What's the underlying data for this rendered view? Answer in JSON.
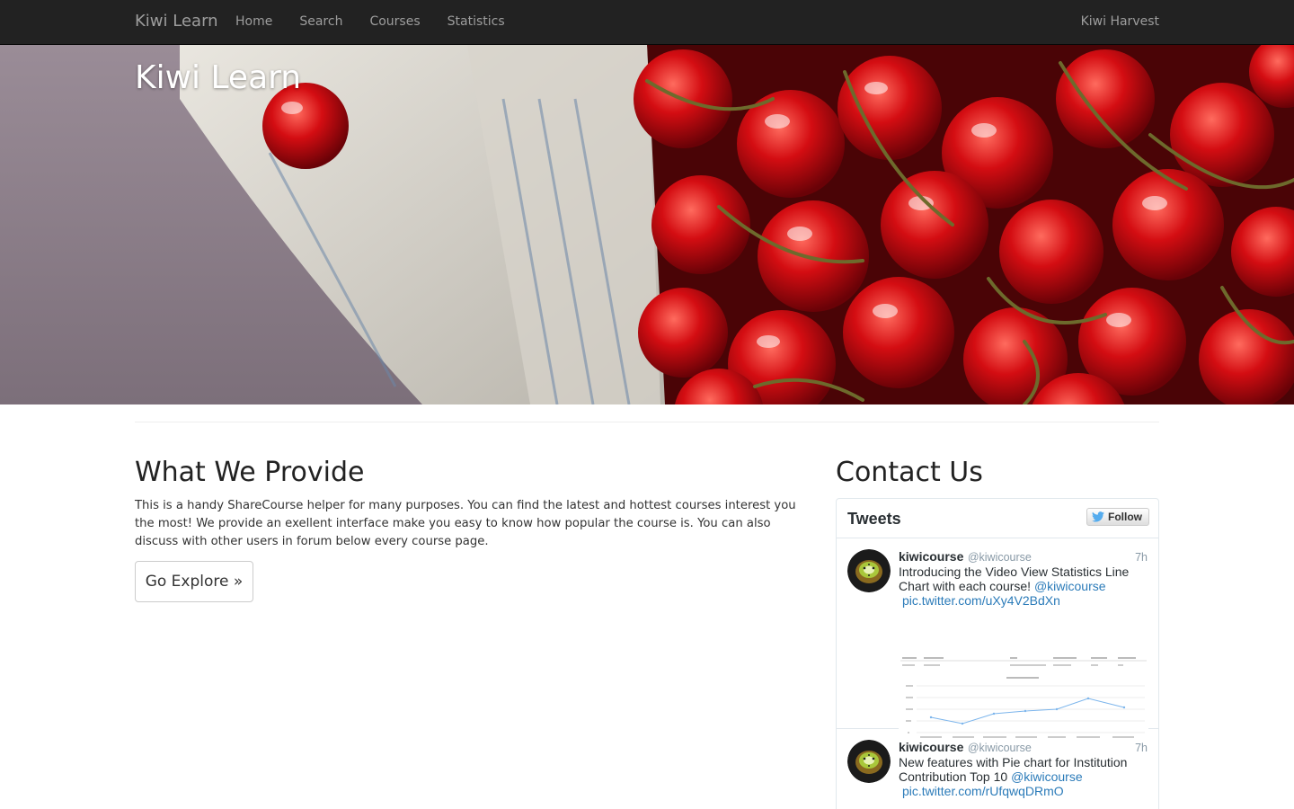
{
  "navbar": {
    "brand": "Kiwi Learn",
    "items": [
      {
        "label": "Home"
      },
      {
        "label": "Search"
      },
      {
        "label": "Courses"
      },
      {
        "label": "Statistics"
      }
    ],
    "right_link": "Kiwi Harvest"
  },
  "hero": {
    "title": "Kiwi Learn"
  },
  "provide": {
    "title": "What We Provide",
    "text": "This is a handy ShareCourse helper for many purposes. You can find the latest and hottest courses interest you the most! We provide an exellent interface make you easy to know how popular the course is. You can also discuss with other users in forum below every course page.",
    "button": "Go Explore »"
  },
  "contact": {
    "title": "Contact Us",
    "widget": {
      "title": "Tweets",
      "follow_label": "Follow",
      "tweets": [
        {
          "name": "kiwicourse",
          "handle": "@kiwicourse",
          "time": "7h",
          "text": "Introducing the Video View Statistics Line Chart with each course!",
          "mention": "@kiwicourse",
          "link": "pic.twitter.com/uXy4V2BdXn"
        },
        {
          "name": "kiwicourse",
          "handle": "@kiwicourse",
          "time": "7h",
          "text": "New features with Pie chart for Institution Contribution Top 10",
          "mention": "@kiwicourse",
          "link": "pic.twitter.com/rUfqwqDRmO"
        }
      ]
    }
  },
  "colors": {
    "navbar_bg": "#222222",
    "link_blue": "#2b7bb9",
    "twitter_blue": "#55acee"
  }
}
